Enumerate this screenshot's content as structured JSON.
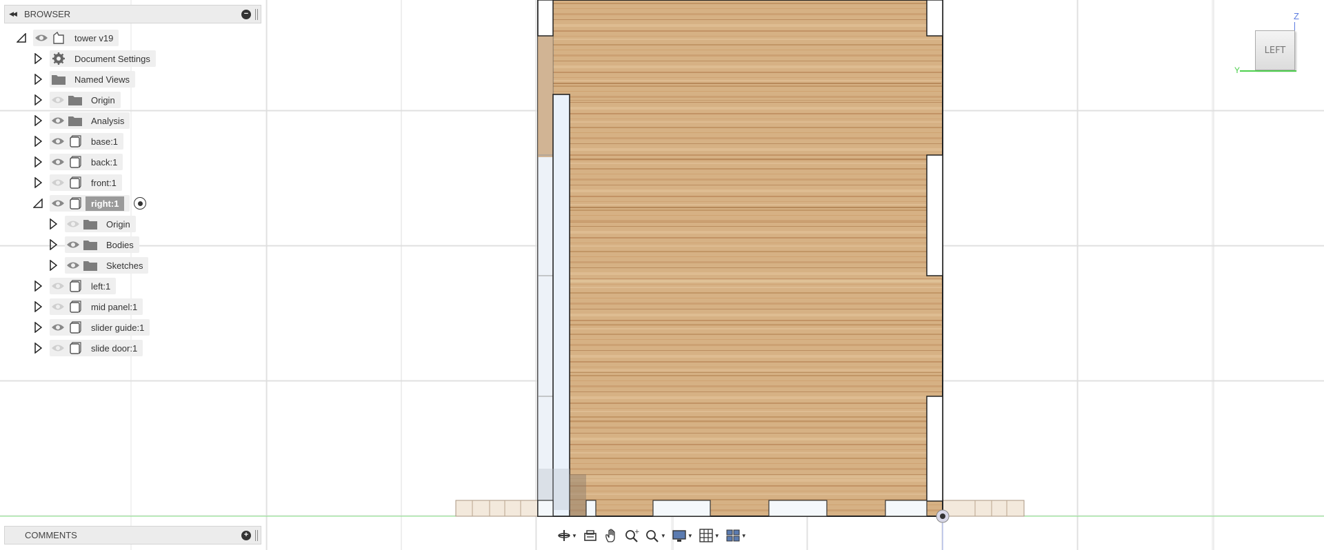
{
  "browser": {
    "title": "BROWSER",
    "collapse_icon": "double-chevron-left-icon",
    "items": [
      {
        "label": "tower v19",
        "level": 0,
        "expanded": true,
        "visible": true,
        "icon": "component-icon"
      },
      {
        "label": "Document Settings",
        "level": 1,
        "expanded": false,
        "icon": "gear-icon"
      },
      {
        "label": "Named Views",
        "level": 1,
        "expanded": false,
        "icon": "folder-icon"
      },
      {
        "label": "Origin",
        "level": 1,
        "expanded": false,
        "visible": false,
        "icon": "folder-icon"
      },
      {
        "label": "Analysis",
        "level": 1,
        "expanded": false,
        "visible": true,
        "icon": "folder-icon"
      },
      {
        "label": "base:1",
        "level": 1,
        "expanded": false,
        "visible": true,
        "icon": "component-box-icon"
      },
      {
        "label": "back:1",
        "level": 1,
        "expanded": false,
        "visible": true,
        "icon": "component-box-icon"
      },
      {
        "label": "front:1",
        "level": 1,
        "expanded": false,
        "visible": false,
        "icon": "component-box-icon"
      },
      {
        "label": "right:1",
        "level": 1,
        "expanded": true,
        "visible": true,
        "active": true,
        "icon": "component-box-icon"
      },
      {
        "label": "Origin",
        "level": 2,
        "expanded": false,
        "visible": false,
        "icon": "folder-icon"
      },
      {
        "label": "Bodies",
        "level": 2,
        "expanded": false,
        "visible": true,
        "icon": "folder-icon"
      },
      {
        "label": "Sketches",
        "level": 2,
        "expanded": false,
        "visible": true,
        "icon": "folder-icon"
      },
      {
        "label": "left:1",
        "level": 1,
        "expanded": false,
        "visible": false,
        "icon": "component-box-icon"
      },
      {
        "label": "mid panel:1",
        "level": 1,
        "expanded": false,
        "visible": false,
        "icon": "component-box-icon"
      },
      {
        "label": "slider guide:1",
        "level": 1,
        "expanded": false,
        "visible": true,
        "icon": "component-box-icon"
      },
      {
        "label": "slide door:1",
        "level": 1,
        "expanded": false,
        "visible": false,
        "icon": "component-box-icon"
      }
    ]
  },
  "comments": {
    "title": "COMMENTS"
  },
  "viewcube": {
    "face_label": "LEFT",
    "axis_z": "Z",
    "axis_y": "Y"
  },
  "toolbar": {
    "tools": [
      "orbit-icon",
      "look-at-icon",
      "pan-icon",
      "zoom-icon",
      "fit-icon",
      "display-settings-icon",
      "grid-settings-icon",
      "viewports-icon"
    ]
  },
  "colors": {
    "wood_light": "#d9b58a",
    "wood_dark": "#b07a4a",
    "panel_bg": "#ececec",
    "active_item": "#9a9a9a",
    "axis_green": "#4cd04c"
  }
}
